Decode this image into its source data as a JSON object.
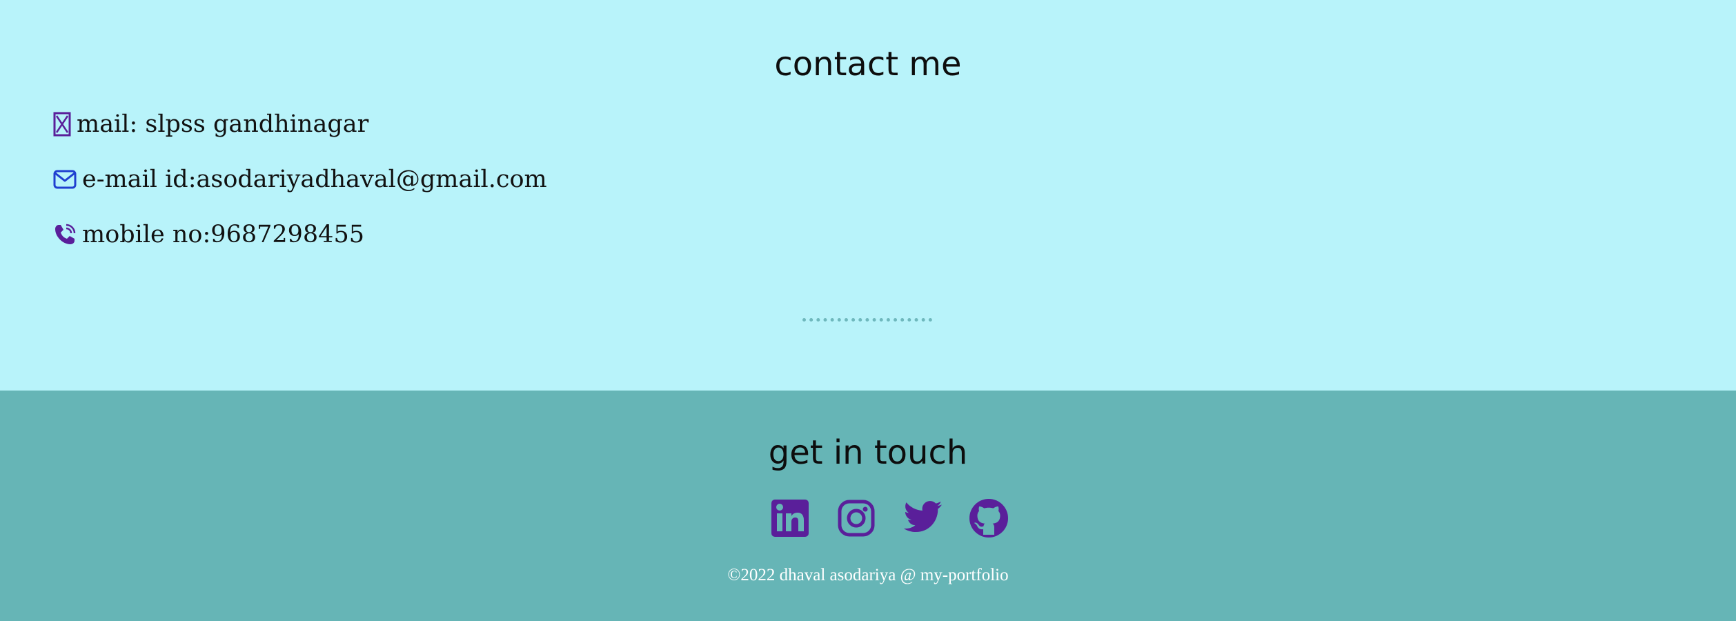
{
  "contact": {
    "title": "contact me",
    "items": [
      {
        "icon": "map-icon",
        "text": "mail: slpss gandhinagar"
      },
      {
        "icon": "envelope-icon",
        "text": "e-mail id:asodariyadhaval@gmail.com"
      },
      {
        "icon": "phone-icon",
        "text": "mobile no:9687298455"
      }
    ]
  },
  "footer": {
    "title": "get in touch",
    "social": [
      {
        "icon": "linkedin-icon"
      },
      {
        "icon": "instagram-icon"
      },
      {
        "icon": "twitter-icon"
      },
      {
        "icon": "github-icon"
      }
    ],
    "copyright": "©2022 dhaval asodariya @ my-portfolio"
  },
  "colors": {
    "contact_bg": "#b8f3fa",
    "footer_bg": "#66b5b6",
    "icon_purple": "#5a1f9a",
    "envelope_blue": "#1f3fd0",
    "copyright_text": "#ffffff"
  }
}
